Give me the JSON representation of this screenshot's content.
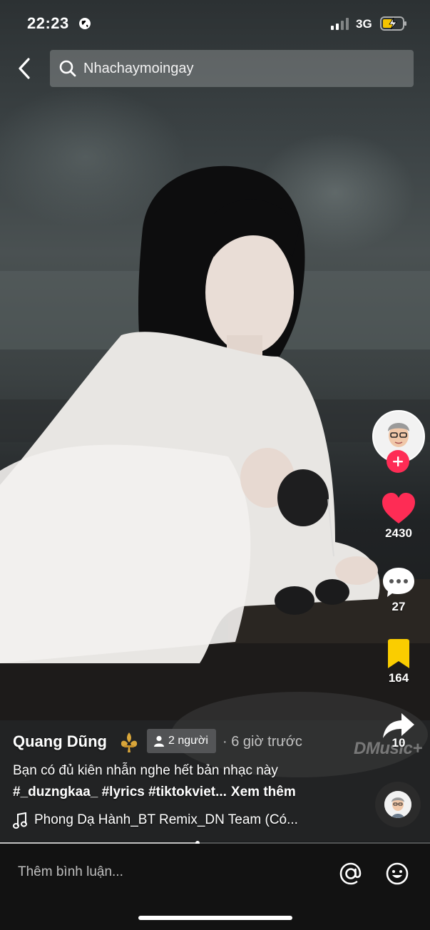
{
  "status_bar": {
    "time": "22:23",
    "network": "3G"
  },
  "search": {
    "query": "Nhachaymoingay"
  },
  "actions": {
    "likes": "2430",
    "comments": "27",
    "saves": "164",
    "shares": "10"
  },
  "watermark": "DMusic+",
  "post": {
    "author": "Quang Dũng",
    "friends_badge": "2 người",
    "time_ago": "· 6 giờ trước",
    "caption": "Bạn có đủ kiên nhẫn nghe hết bản nhạc này",
    "hashtags": "#_duzngkaa_ #lyrics #tiktokviet...",
    "see_more": "Xem thêm",
    "music": "Phong Dạ Hành_BT Remix_DN Team (Có..."
  },
  "progress": {
    "value": 0.46
  },
  "comment_bar": {
    "placeholder": "Thêm bình luận..."
  },
  "colors": {
    "like": "#fe2c55",
    "save": "#facd00",
    "follow": "#fe2c55"
  },
  "icons": {
    "back": "chevron-left-icon",
    "search": "search-icon",
    "like": "heart-icon",
    "comment": "comment-bubble-icon",
    "save": "bookmark-icon",
    "share": "share-arrow-icon",
    "music": "music-note-icon",
    "mention": "at-sign-icon",
    "emoji": "smiley-icon"
  }
}
